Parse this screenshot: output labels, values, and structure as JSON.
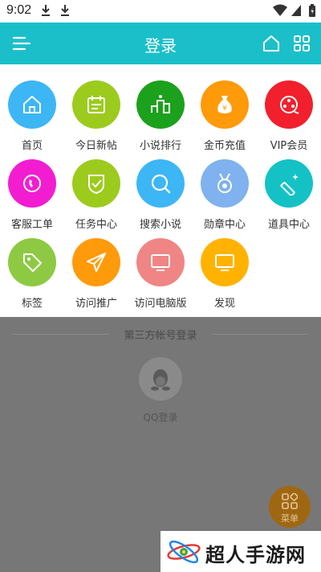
{
  "status_bar": {
    "time": "9:02"
  },
  "header": {
    "title": "登录",
    "home_icon": "home-icon",
    "grid_icon": "apps-grid-icon",
    "menu_icon": "hamburger-icon"
  },
  "grid": {
    "items": [
      {
        "label": "首页",
        "color": "#3db6f5",
        "icon": "home-icon"
      },
      {
        "label": "今日新帖",
        "color": "#9ccb1e",
        "icon": "calendar-icon"
      },
      {
        "label": "小说排行",
        "color": "#1ca11c",
        "icon": "podium-icon"
      },
      {
        "label": "金币充值",
        "color": "#ff9a0a",
        "icon": "money-bag-icon"
      },
      {
        "label": "VIP会员",
        "color": "#f1202c",
        "icon": "vip-badge-icon"
      },
      {
        "label": "客服工单",
        "color": "#f21dd1",
        "icon": "phone-icon"
      },
      {
        "label": "任务中心",
        "color": "#9ccb1e",
        "icon": "check-shield-icon"
      },
      {
        "label": "搜索小说",
        "color": "#3db6f5",
        "icon": "search-icon"
      },
      {
        "label": "勋章中心",
        "color": "#7fb2ee",
        "icon": "medal-icon"
      },
      {
        "label": "道具中心",
        "color": "#14c2c6",
        "icon": "magic-wand-icon"
      },
      {
        "label": "标签",
        "color": "#8ec943",
        "icon": "tag-icon"
      },
      {
        "label": "访问推广",
        "color": "#ff9a0a",
        "icon": "paper-plane-icon"
      },
      {
        "label": "访问电脑版",
        "color": "#f08585",
        "icon": "monitor-icon"
      },
      {
        "label": "发现",
        "color": "#ffb300",
        "icon": "monitor-icon"
      }
    ]
  },
  "third_party": {
    "label": "第三方帐号登录",
    "qq_label": "QQ登录",
    "qq_icon": "qq-penguin-icon"
  },
  "menu_fab": {
    "label": "菜单",
    "icon": "apps-grid-icon"
  },
  "watermark": {
    "text": "超人手游网"
  }
}
